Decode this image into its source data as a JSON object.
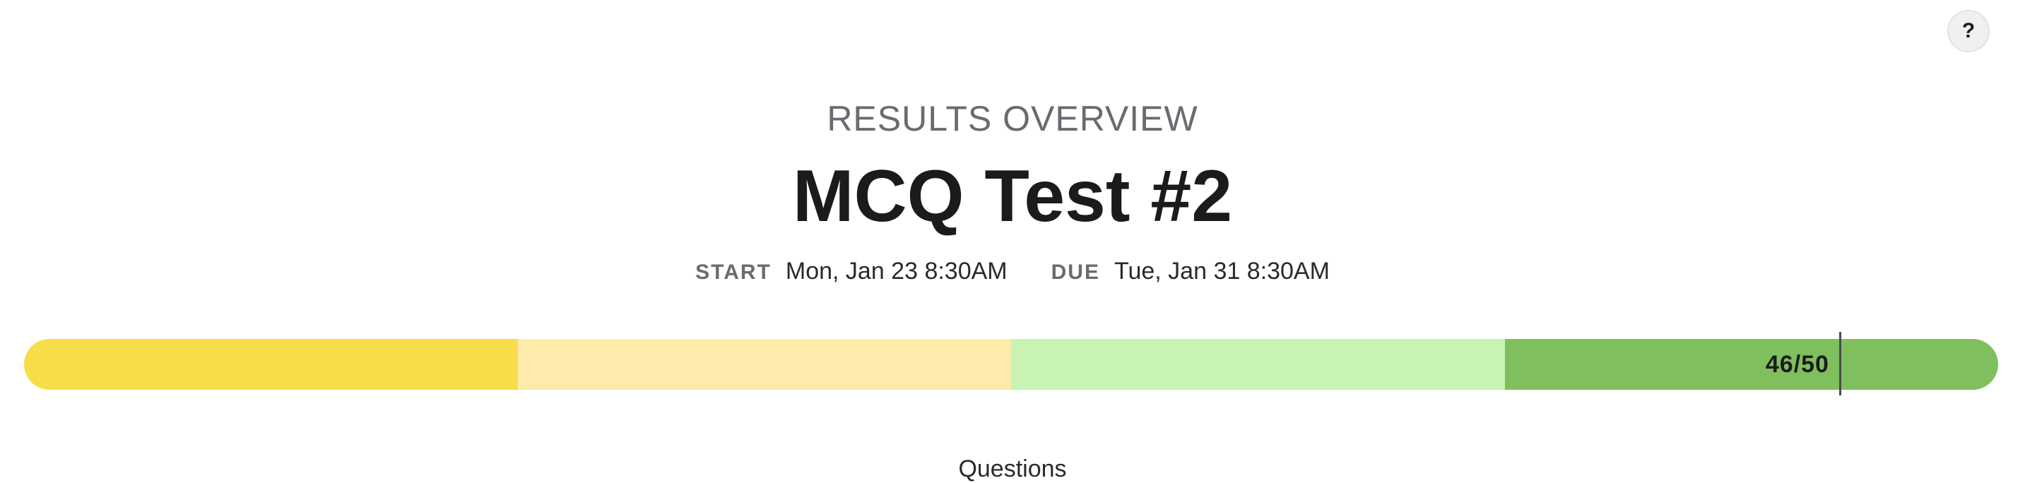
{
  "help": {
    "label": "?"
  },
  "header": {
    "overline": "RESULTS OVERVIEW",
    "title": "MCQ Test #2"
  },
  "dates": {
    "start_label": "START",
    "start_value": "Mon, Jan 23 8:30AM",
    "due_label": "DUE",
    "due_value": "Tue, Jan 31 8:30AM"
  },
  "score": {
    "text": "46/50",
    "earned": 46,
    "total": 50
  },
  "progress_segments": [
    {
      "color": "#f8dd4a"
    },
    {
      "color": "#fcebaa"
    },
    {
      "color": "#c8f3b2"
    },
    {
      "color": "#80bf5d"
    }
  ],
  "below": {
    "cutoff_label": "Questions"
  }
}
